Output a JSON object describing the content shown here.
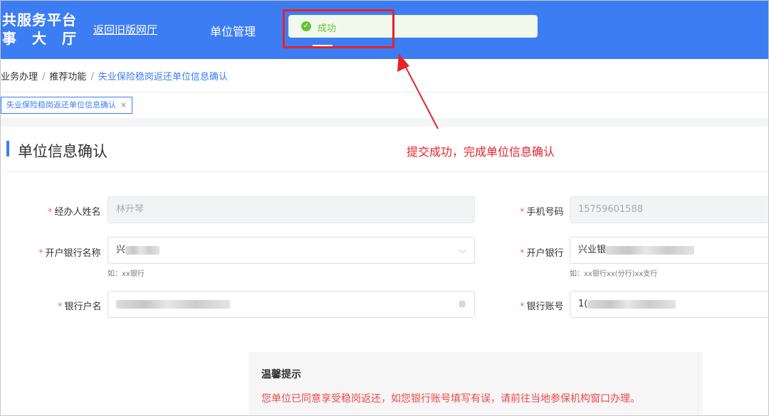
{
  "header": {
    "brand_line1": "共服务平台",
    "brand_line2": "事大厅",
    "nav_old_hall": "返回旧版网厅",
    "nav_unit_mgmt": "单位管理",
    "toast_text": "成功"
  },
  "breadcrumb": {
    "items": [
      "业务办理",
      "推荐功能",
      "失业保险稳岗返还单位信息确认"
    ]
  },
  "tab": {
    "label": "失业保险稳岗返还单位信息确认",
    "close": "×"
  },
  "section": {
    "title": "单位信息确认"
  },
  "annotation": {
    "text": "提交成功，完成单位信息确认",
    "color": "#e8212a"
  },
  "form": {
    "handler_name": {
      "label": "经办人姓名",
      "value": "林升琴"
    },
    "phone": {
      "label": "手机号码",
      "value": "15759601588"
    },
    "bank_name": {
      "label": "开户银行名称",
      "value_prefix": "兴",
      "hint": "如：xx银行"
    },
    "bank_branch": {
      "label": "开户银行",
      "value_prefix": "兴业银",
      "hint": "如：xx银行xx(分行)xx支行"
    },
    "account_name": {
      "label": "银行户名"
    },
    "account_no": {
      "label": "银行账号",
      "value_prefix": "1("
    }
  },
  "tip": {
    "title": "温馨提示",
    "text": "您单位已同意享受稳岗返还，如您银行账号填写有误，请前往当地参保机构窗口办理。"
  },
  "colors": {
    "primary": "#3d7df3",
    "success": "#67c23a",
    "danger": "#f56c6c"
  }
}
